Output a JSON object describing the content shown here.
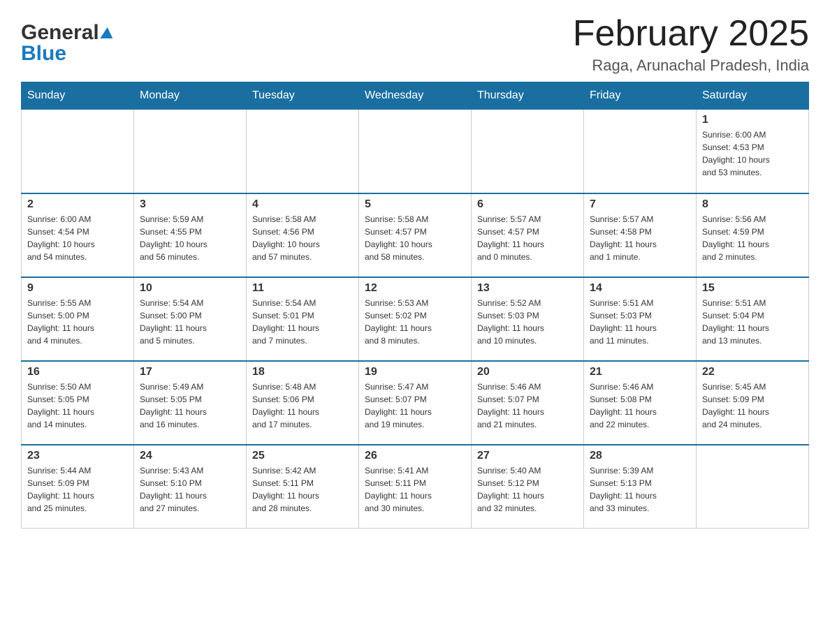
{
  "header": {
    "logo": {
      "general": "General",
      "blue": "Blue",
      "arrow": "▶"
    },
    "title": "February 2025",
    "location": "Raga, Arunachal Pradesh, India"
  },
  "days_of_week": [
    "Sunday",
    "Monday",
    "Tuesday",
    "Wednesday",
    "Thursday",
    "Friday",
    "Saturday"
  ],
  "weeks": [
    {
      "cells": [
        {
          "day": "",
          "info": ""
        },
        {
          "day": "",
          "info": ""
        },
        {
          "day": "",
          "info": ""
        },
        {
          "day": "",
          "info": ""
        },
        {
          "day": "",
          "info": ""
        },
        {
          "day": "",
          "info": ""
        },
        {
          "day": "1",
          "info": "Sunrise: 6:00 AM\nSunset: 4:53 PM\nDaylight: 10 hours\nand 53 minutes."
        }
      ]
    },
    {
      "cells": [
        {
          "day": "2",
          "info": "Sunrise: 6:00 AM\nSunset: 4:54 PM\nDaylight: 10 hours\nand 54 minutes."
        },
        {
          "day": "3",
          "info": "Sunrise: 5:59 AM\nSunset: 4:55 PM\nDaylight: 10 hours\nand 56 minutes."
        },
        {
          "day": "4",
          "info": "Sunrise: 5:58 AM\nSunset: 4:56 PM\nDaylight: 10 hours\nand 57 minutes."
        },
        {
          "day": "5",
          "info": "Sunrise: 5:58 AM\nSunset: 4:57 PM\nDaylight: 10 hours\nand 58 minutes."
        },
        {
          "day": "6",
          "info": "Sunrise: 5:57 AM\nSunset: 4:57 PM\nDaylight: 11 hours\nand 0 minutes."
        },
        {
          "day": "7",
          "info": "Sunrise: 5:57 AM\nSunset: 4:58 PM\nDaylight: 11 hours\nand 1 minute."
        },
        {
          "day": "8",
          "info": "Sunrise: 5:56 AM\nSunset: 4:59 PM\nDaylight: 11 hours\nand 2 minutes."
        }
      ]
    },
    {
      "cells": [
        {
          "day": "9",
          "info": "Sunrise: 5:55 AM\nSunset: 5:00 PM\nDaylight: 11 hours\nand 4 minutes."
        },
        {
          "day": "10",
          "info": "Sunrise: 5:54 AM\nSunset: 5:00 PM\nDaylight: 11 hours\nand 5 minutes."
        },
        {
          "day": "11",
          "info": "Sunrise: 5:54 AM\nSunset: 5:01 PM\nDaylight: 11 hours\nand 7 minutes."
        },
        {
          "day": "12",
          "info": "Sunrise: 5:53 AM\nSunset: 5:02 PM\nDaylight: 11 hours\nand 8 minutes."
        },
        {
          "day": "13",
          "info": "Sunrise: 5:52 AM\nSunset: 5:03 PM\nDaylight: 11 hours\nand 10 minutes."
        },
        {
          "day": "14",
          "info": "Sunrise: 5:51 AM\nSunset: 5:03 PM\nDaylight: 11 hours\nand 11 minutes."
        },
        {
          "day": "15",
          "info": "Sunrise: 5:51 AM\nSunset: 5:04 PM\nDaylight: 11 hours\nand 13 minutes."
        }
      ]
    },
    {
      "cells": [
        {
          "day": "16",
          "info": "Sunrise: 5:50 AM\nSunset: 5:05 PM\nDaylight: 11 hours\nand 14 minutes."
        },
        {
          "day": "17",
          "info": "Sunrise: 5:49 AM\nSunset: 5:05 PM\nDaylight: 11 hours\nand 16 minutes."
        },
        {
          "day": "18",
          "info": "Sunrise: 5:48 AM\nSunset: 5:06 PM\nDaylight: 11 hours\nand 17 minutes."
        },
        {
          "day": "19",
          "info": "Sunrise: 5:47 AM\nSunset: 5:07 PM\nDaylight: 11 hours\nand 19 minutes."
        },
        {
          "day": "20",
          "info": "Sunrise: 5:46 AM\nSunset: 5:07 PM\nDaylight: 11 hours\nand 21 minutes."
        },
        {
          "day": "21",
          "info": "Sunrise: 5:46 AM\nSunset: 5:08 PM\nDaylight: 11 hours\nand 22 minutes."
        },
        {
          "day": "22",
          "info": "Sunrise: 5:45 AM\nSunset: 5:09 PM\nDaylight: 11 hours\nand 24 minutes."
        }
      ]
    },
    {
      "cells": [
        {
          "day": "23",
          "info": "Sunrise: 5:44 AM\nSunset: 5:09 PM\nDaylight: 11 hours\nand 25 minutes."
        },
        {
          "day": "24",
          "info": "Sunrise: 5:43 AM\nSunset: 5:10 PM\nDaylight: 11 hours\nand 27 minutes."
        },
        {
          "day": "25",
          "info": "Sunrise: 5:42 AM\nSunset: 5:11 PM\nDaylight: 11 hours\nand 28 minutes."
        },
        {
          "day": "26",
          "info": "Sunrise: 5:41 AM\nSunset: 5:11 PM\nDaylight: 11 hours\nand 30 minutes."
        },
        {
          "day": "27",
          "info": "Sunrise: 5:40 AM\nSunset: 5:12 PM\nDaylight: 11 hours\nand 32 minutes."
        },
        {
          "day": "28",
          "info": "Sunrise: 5:39 AM\nSunset: 5:13 PM\nDaylight: 11 hours\nand 33 minutes."
        },
        {
          "day": "",
          "info": ""
        }
      ]
    }
  ]
}
